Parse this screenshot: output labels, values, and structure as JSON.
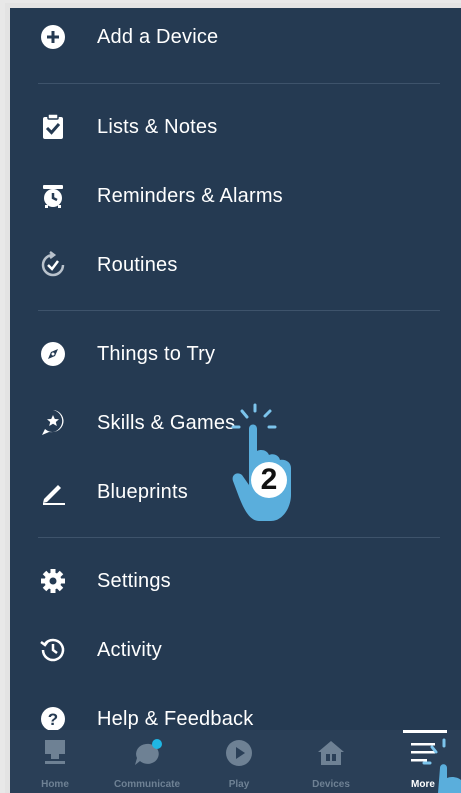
{
  "menu": {
    "items": [
      {
        "label": "Add a Device",
        "icon": "add-circle-icon"
      },
      {
        "label": "Lists & Notes",
        "icon": "clipboard-check-icon"
      },
      {
        "label": "Reminders & Alarms",
        "icon": "alarm-clock-icon"
      },
      {
        "label": "Routines",
        "icon": "routines-icon"
      },
      {
        "label": "Things to Try",
        "icon": "compass-icon"
      },
      {
        "label": "Skills & Games",
        "icon": "skills-icon"
      },
      {
        "label": "Blueprints",
        "icon": "pencil-icon"
      },
      {
        "label": "Settings",
        "icon": "gear-icon"
      },
      {
        "label": "Activity",
        "icon": "history-icon"
      },
      {
        "label": "Help & Feedback",
        "icon": "help-icon"
      }
    ]
  },
  "tabs": [
    {
      "label": "Home",
      "icon": "home-icon",
      "active": false
    },
    {
      "label": "Communicate",
      "icon": "chat-icon",
      "active": false
    },
    {
      "label": "Play",
      "icon": "play-icon",
      "active": false
    },
    {
      "label": "Devices",
      "icon": "devices-icon",
      "active": false
    },
    {
      "label": "More",
      "icon": "menu-lines-icon",
      "active": true
    }
  ],
  "annotation": {
    "step_number": "2"
  },
  "colors": {
    "background": "#253a52",
    "accent": "#1fb7e4",
    "hand": "#5aaedc"
  }
}
